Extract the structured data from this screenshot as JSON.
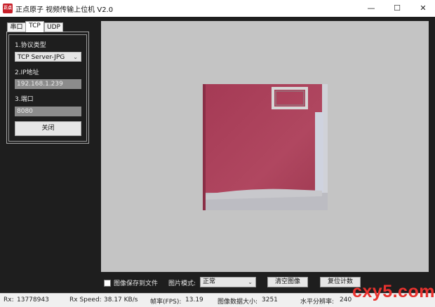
{
  "window": {
    "logo_text": "正点",
    "title": "正点原子 视频传输上位机 V2.0",
    "minimize_glyph": "—",
    "maximize_glyph": "☐",
    "close_glyph": "✕"
  },
  "tabs": [
    "串口",
    "TCP",
    "UDP"
  ],
  "panel": {
    "protocol_label": "1.协议类型",
    "protocol_value": "TCP Server-JPG",
    "ip_label": "2.IP地址",
    "ip_value": "192.168.1.239",
    "port_label": "3.端口",
    "port_value": "8080",
    "close_button": "关闭"
  },
  "controls": {
    "save_checkbox_label": "图像保存到文件",
    "save_checked": false,
    "mode_label": "图片模式:",
    "mode_value": "正常",
    "clear_button": "清空图像",
    "reset_button": "复位计数"
  },
  "status": {
    "rx_label": "Rx:",
    "rx_value": "13778943",
    "speed_label": "Rx Speed:",
    "speed_value": "38.17 KB/s",
    "fps_label": "帧率(FPS):",
    "fps_value": "13.19",
    "size_label": "图像数据大小:",
    "size_value": "3251",
    "hres_label": "水平分辨率:",
    "hres_value": "240"
  },
  "watermark": "cxy5.com"
}
